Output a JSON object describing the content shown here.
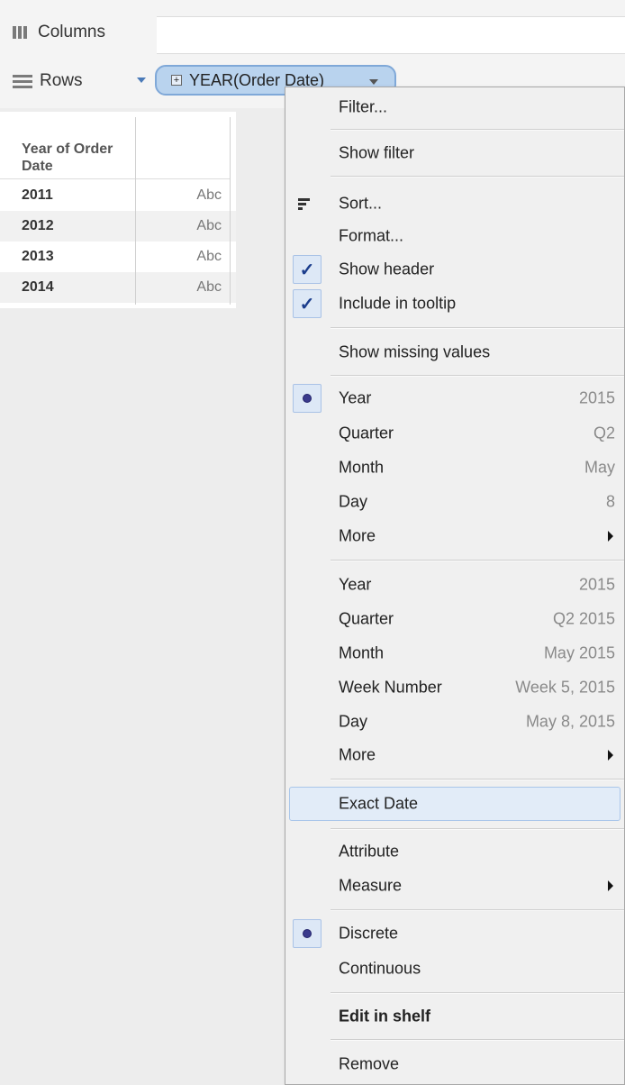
{
  "shelves": {
    "columns_label": "Columns",
    "rows_label": "Rows",
    "pill_label": "YEAR(Order Date)",
    "pill_plus": "⊞"
  },
  "table": {
    "header": "Year of Order Date",
    "rows": [
      {
        "year": "2011",
        "value": "Abc"
      },
      {
        "year": "2012",
        "value": "Abc"
      },
      {
        "year": "2013",
        "value": "Abc"
      },
      {
        "year": "2014",
        "value": "Abc"
      }
    ]
  },
  "menu": {
    "filter": "Filter...",
    "show_filter": "Show filter",
    "sort": "Sort...",
    "format": "Format...",
    "show_header": "Show header",
    "include_tooltip": "Include in tooltip",
    "show_missing": "Show missing values",
    "date_parts": [
      {
        "label": "Year",
        "value": "2015"
      },
      {
        "label": "Quarter",
        "value": "Q2"
      },
      {
        "label": "Month",
        "value": "May"
      },
      {
        "label": "Day",
        "value": "8"
      },
      {
        "label": "More",
        "value": ""
      }
    ],
    "date_values": [
      {
        "label": "Year",
        "value": "2015"
      },
      {
        "label": "Quarter",
        "value": "Q2 2015"
      },
      {
        "label": "Month",
        "value": "May 2015"
      },
      {
        "label": "Week Number",
        "value": "Week 5, 2015"
      },
      {
        "label": "Day",
        "value": "May 8, 2015"
      },
      {
        "label": "More",
        "value": ""
      }
    ],
    "exact_date": "Exact Date",
    "attribute": "Attribute",
    "measure": "Measure",
    "discrete": "Discrete",
    "continuous": "Continuous",
    "edit_in_shelf": "Edit in shelf",
    "remove": "Remove",
    "check_glyph": "✓"
  },
  "colors": {
    "pill_bg": "#b9d3ee",
    "check_color": "#1b3d8c",
    "radio_dot": "#3a3a8c"
  }
}
